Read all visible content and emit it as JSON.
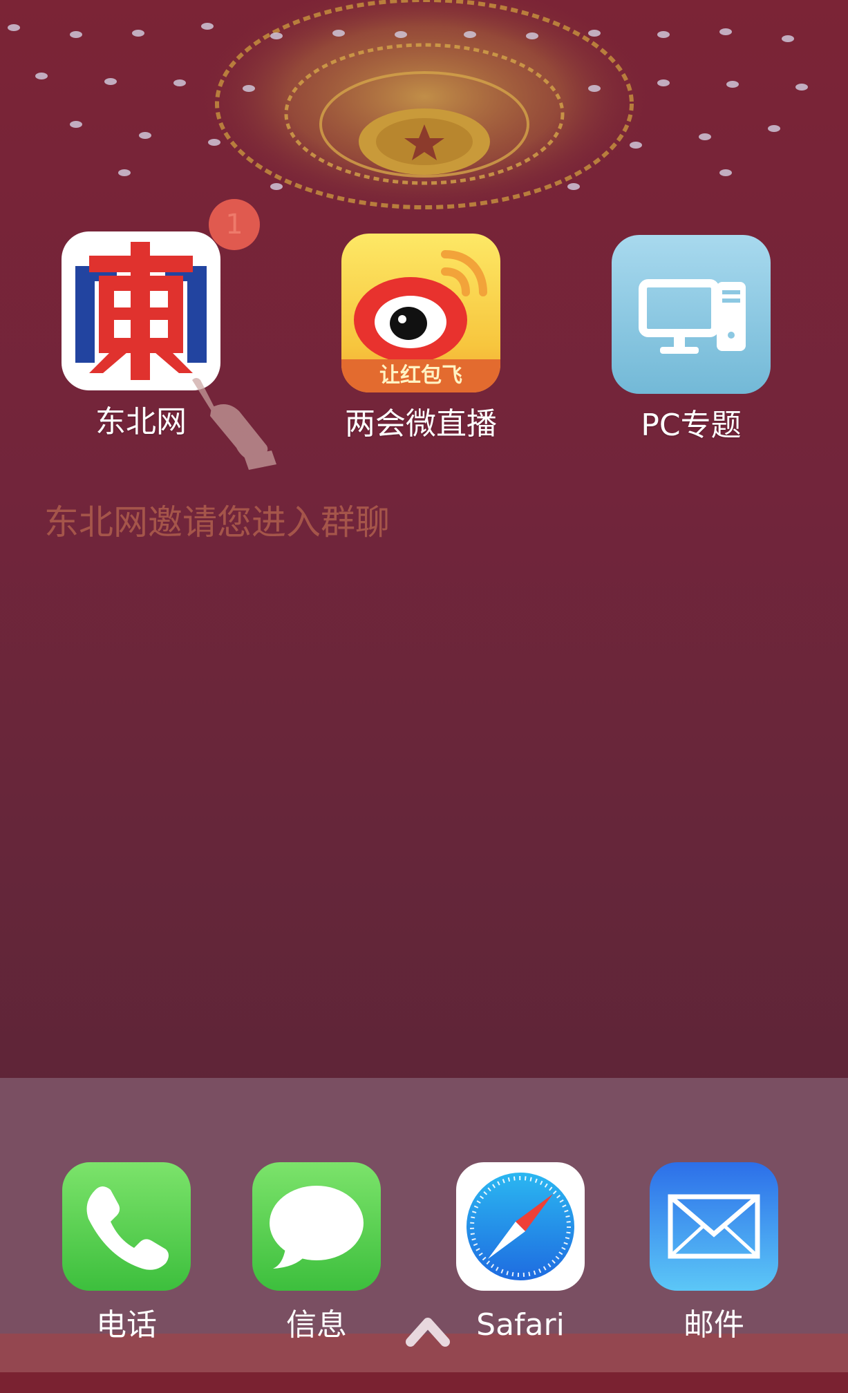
{
  "home": {
    "apps": [
      {
        "label": "东北网",
        "badge": "1",
        "icon": "dongbei-logo-icon"
      },
      {
        "label": "两会微直播",
        "icon": "weibo-icon",
        "banner": "让红包飞"
      },
      {
        "label": "PC专题",
        "icon": "computer-icon"
      }
    ],
    "invite_text": "东北网邀请您进入群聊"
  },
  "dock": {
    "apps": [
      {
        "label": "电话",
        "icon": "phone-icon"
      },
      {
        "label": "信息",
        "icon": "messages-icon"
      },
      {
        "label": "Safari",
        "icon": "safari-compass-icon"
      },
      {
        "label": "邮件",
        "icon": "mail-icon"
      }
    ]
  },
  "colors": {
    "wallpaper": "#7b2436",
    "badge": "#e05a4f",
    "invite_text": "#a5554a",
    "dock": "#7a4f62"
  }
}
